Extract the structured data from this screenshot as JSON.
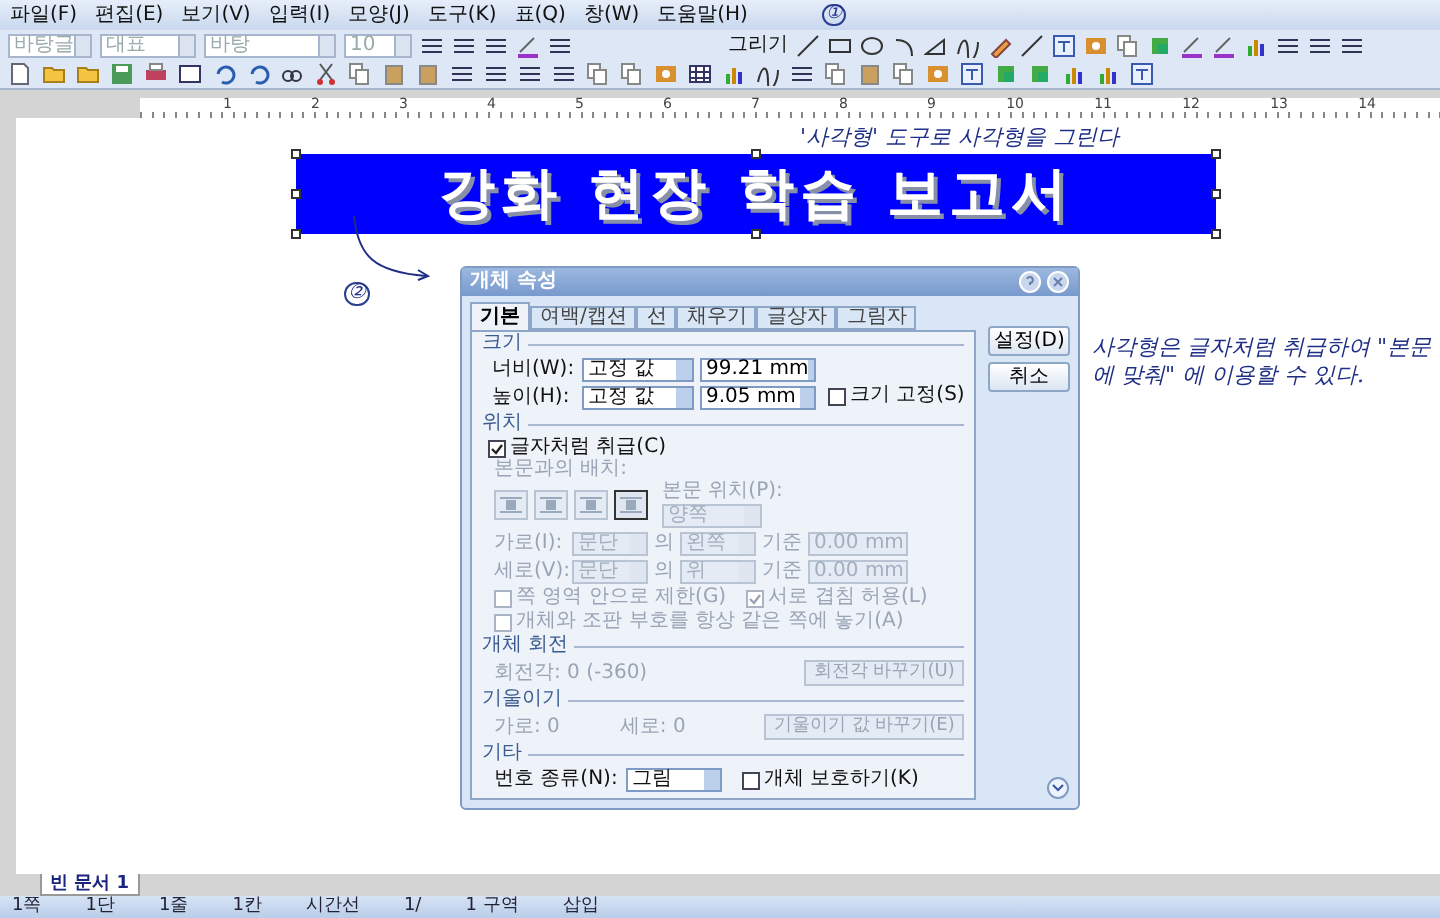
{
  "menu": [
    "파일(F)",
    "편집(E)",
    "보기(V)",
    "입력(I)",
    "모양(J)",
    "도구(K)",
    "표(Q)",
    "창(W)",
    "도움말(H)"
  ],
  "format_toolbar": {
    "style": "바탕글",
    "font_lang": "대표",
    "font": "바탕",
    "size": "10",
    "draw_menu": "그리기"
  },
  "ruler": {
    "labels": [
      "1",
      "2",
      "3",
      "4",
      "5",
      "6",
      "7",
      "8",
      "9",
      "10",
      "11",
      "12",
      "13",
      "14"
    ]
  },
  "document": {
    "banner_text": "강화 현장 학습 보고서",
    "banner_selected": true
  },
  "annotations": [
    {
      "kind": "marker",
      "text": "①"
    },
    {
      "kind": "note",
      "text": "'사각형' 도구로 사각형을 그린다"
    },
    {
      "kind": "marker",
      "text": "②"
    },
    {
      "kind": "note",
      "text": "사각형은 글자처럼 취급하여 \"본문에 맞춰\" 에 이용할 수 있다."
    }
  ],
  "dialog": {
    "title": "개체 속성",
    "tabs": [
      {
        "label": "기본",
        "selected": true
      },
      {
        "label": "여백/캡션",
        "selected": false
      },
      {
        "label": "선",
        "selected": false
      },
      {
        "label": "채우기",
        "selected": false
      },
      {
        "label": "글상자",
        "selected": false
      },
      {
        "label": "그림자",
        "selected": false
      }
    ],
    "buttons": [
      "설정(D)",
      "취소"
    ],
    "size": {
      "heading": "크기",
      "rows": [
        {
          "label": "너비(W):",
          "mode": "고정 값",
          "value": "99.21 mm"
        },
        {
          "label": "높이(H):",
          "mode": "고정 값",
          "value": "9.05 mm"
        }
      ],
      "lock": {
        "label": "크기 고정(S)",
        "checked": false
      }
    },
    "position": {
      "heading": "위치",
      "disabled": true,
      "treat_as_char": {
        "label": "글자처럼 취급(C)",
        "checked": true
      },
      "wrap_label": "본문과의 배치:",
      "wrap_options": [
        {
          "selected": false
        },
        {
          "selected": false
        },
        {
          "selected": false
        },
        {
          "selected": true
        }
      ],
      "text_pos_label": "본문 위치(P):",
      "text_pos_value": "양쪽",
      "rows": [
        {
          "label": "가로(I):",
          "ref": "문단",
          "of": "의",
          "side": "왼쪽",
          "base": "기준",
          "offset": "0.00 mm"
        },
        {
          "label": "세로(V):",
          "ref": "문단",
          "of": "의",
          "side": "위",
          "base": "기준",
          "offset": "0.00 mm"
        }
      ],
      "checks": [
        {
          "label": "쪽 영역 안으로 제한(G)",
          "checked": false
        },
        {
          "label": "서로 겹침 허용(L)",
          "checked": true
        },
        {
          "label": "개체와 조판 부호를 항상 같은 쪽에 놓기(A)",
          "checked": false
        }
      ]
    },
    "rotation": {
      "heading": "개체 회전",
      "disabled": true,
      "text": "회전각: 0 (-360)",
      "button": "회전각 바꾸기(U)"
    },
    "skew": {
      "heading": "기울이기",
      "disabled": true,
      "h": "가로: 0",
      "v": "세로: 0",
      "button": "기울이기 값 바꾸기(E)"
    },
    "other": {
      "heading": "기타",
      "number_label": "번호 종류(N):",
      "number_value": "그림",
      "protect": {
        "label": "개체 보호하기(K)",
        "checked": false
      }
    }
  },
  "doc_tabs": [
    {
      "label": "빈 문서 1",
      "selected": true
    }
  ],
  "status_bar": [
    "1쪽",
    "1단",
    "1줄",
    "1칸",
    "시간선",
    "1/",
    "1 구역",
    "삽입"
  ]
}
